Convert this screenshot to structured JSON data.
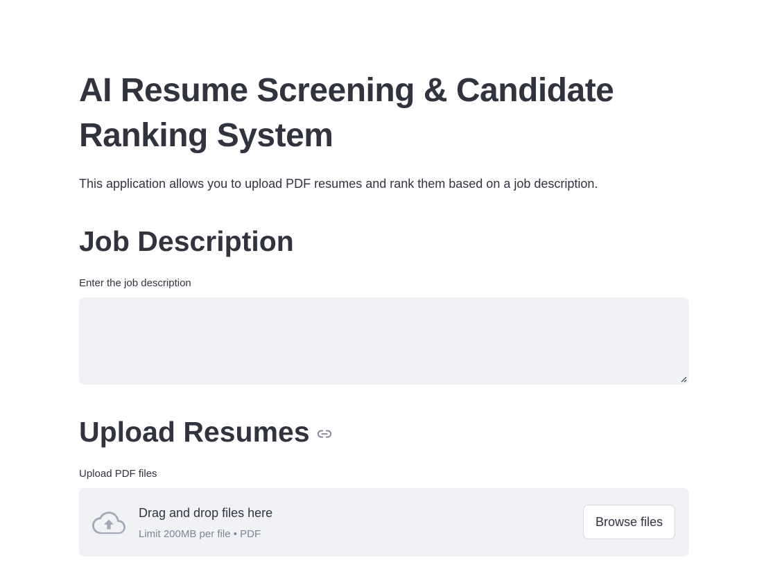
{
  "page": {
    "title": "AI Resume Screening & Candidate Ranking System",
    "intro": "This application allows you to upload PDF resumes and rank them based on a job description."
  },
  "job_section": {
    "heading": "Job Description",
    "field_label": "Enter the job description",
    "value": ""
  },
  "upload_section": {
    "heading": "Upload Resumes",
    "anchor_icon": "link-icon",
    "field_label": "Upload PDF files",
    "dropzone": {
      "icon": "cloud-upload-icon",
      "title": "Drag and drop files here",
      "subtitle": "Limit 200MB per file • PDF",
      "button_label": "Browse files"
    }
  },
  "colors": {
    "text": "#31333f",
    "muted": "#808495",
    "input_bg": "#f0f2f6",
    "icon": "#a3a8b8"
  }
}
